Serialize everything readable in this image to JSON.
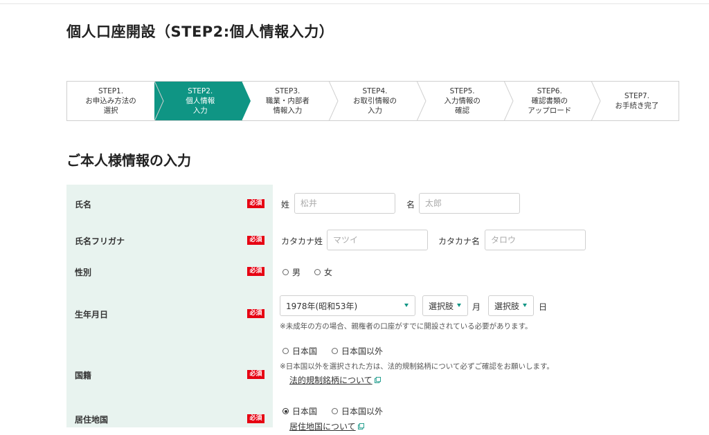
{
  "page": {
    "title": "個人口座開設（STEP2:個人情報入力）",
    "section_title": "ご本人様情報の入力",
    "required_badge": "必須"
  },
  "steps": [
    {
      "label": "STEP1.\nお申込み方法の\n選択",
      "active": false
    },
    {
      "label": "STEP2.\n個人情報\n入力",
      "active": true
    },
    {
      "label": "STEP3.\n職業・内部者\n情報入力",
      "active": false
    },
    {
      "label": "STEP4.\nお取引情報の\n入力",
      "active": false
    },
    {
      "label": "STEP5.\n入力情報の\n確認",
      "active": false
    },
    {
      "label": "STEP6.\n確認書類の\nアップロード",
      "active": false
    },
    {
      "label": "STEP7.\nお手続き完了",
      "active": false
    }
  ],
  "colors": {
    "accent": "#0f9584",
    "label_bg": "#e8f3ef",
    "required": "#e60012"
  },
  "form": {
    "name": {
      "label": "氏名",
      "sei_label": "姓",
      "sei_placeholder": "松井",
      "mei_label": "名",
      "mei_placeholder": "太郎"
    },
    "kana": {
      "label": "氏名フリガナ",
      "sei_label": "カタカナ姓",
      "sei_placeholder": "マツイ",
      "mei_label": "カタカナ名",
      "mei_placeholder": "タロウ"
    },
    "gender": {
      "label": "性別",
      "options": [
        "男",
        "女"
      ]
    },
    "birthday": {
      "label": "生年月日",
      "year_value": "1978年(昭和53年)",
      "month_value": "選択肢",
      "month_unit": "月",
      "day_value": "選択肢",
      "day_unit": "日",
      "note": "※未成年の方の場合、親権者の口座がすでに開設されている必要があります。"
    },
    "nationality": {
      "label": "国籍",
      "options": [
        "日本国",
        "日本国以外"
      ],
      "note": "※日本国以外を選択された方は、法的規制銘柄について必ずご確認をお願いします。",
      "link": "法的規制銘柄について"
    },
    "residence": {
      "label": "居住地国",
      "options": [
        "日本国",
        "日本国以外"
      ],
      "selected": "日本国",
      "link": "居住地国について"
    }
  }
}
